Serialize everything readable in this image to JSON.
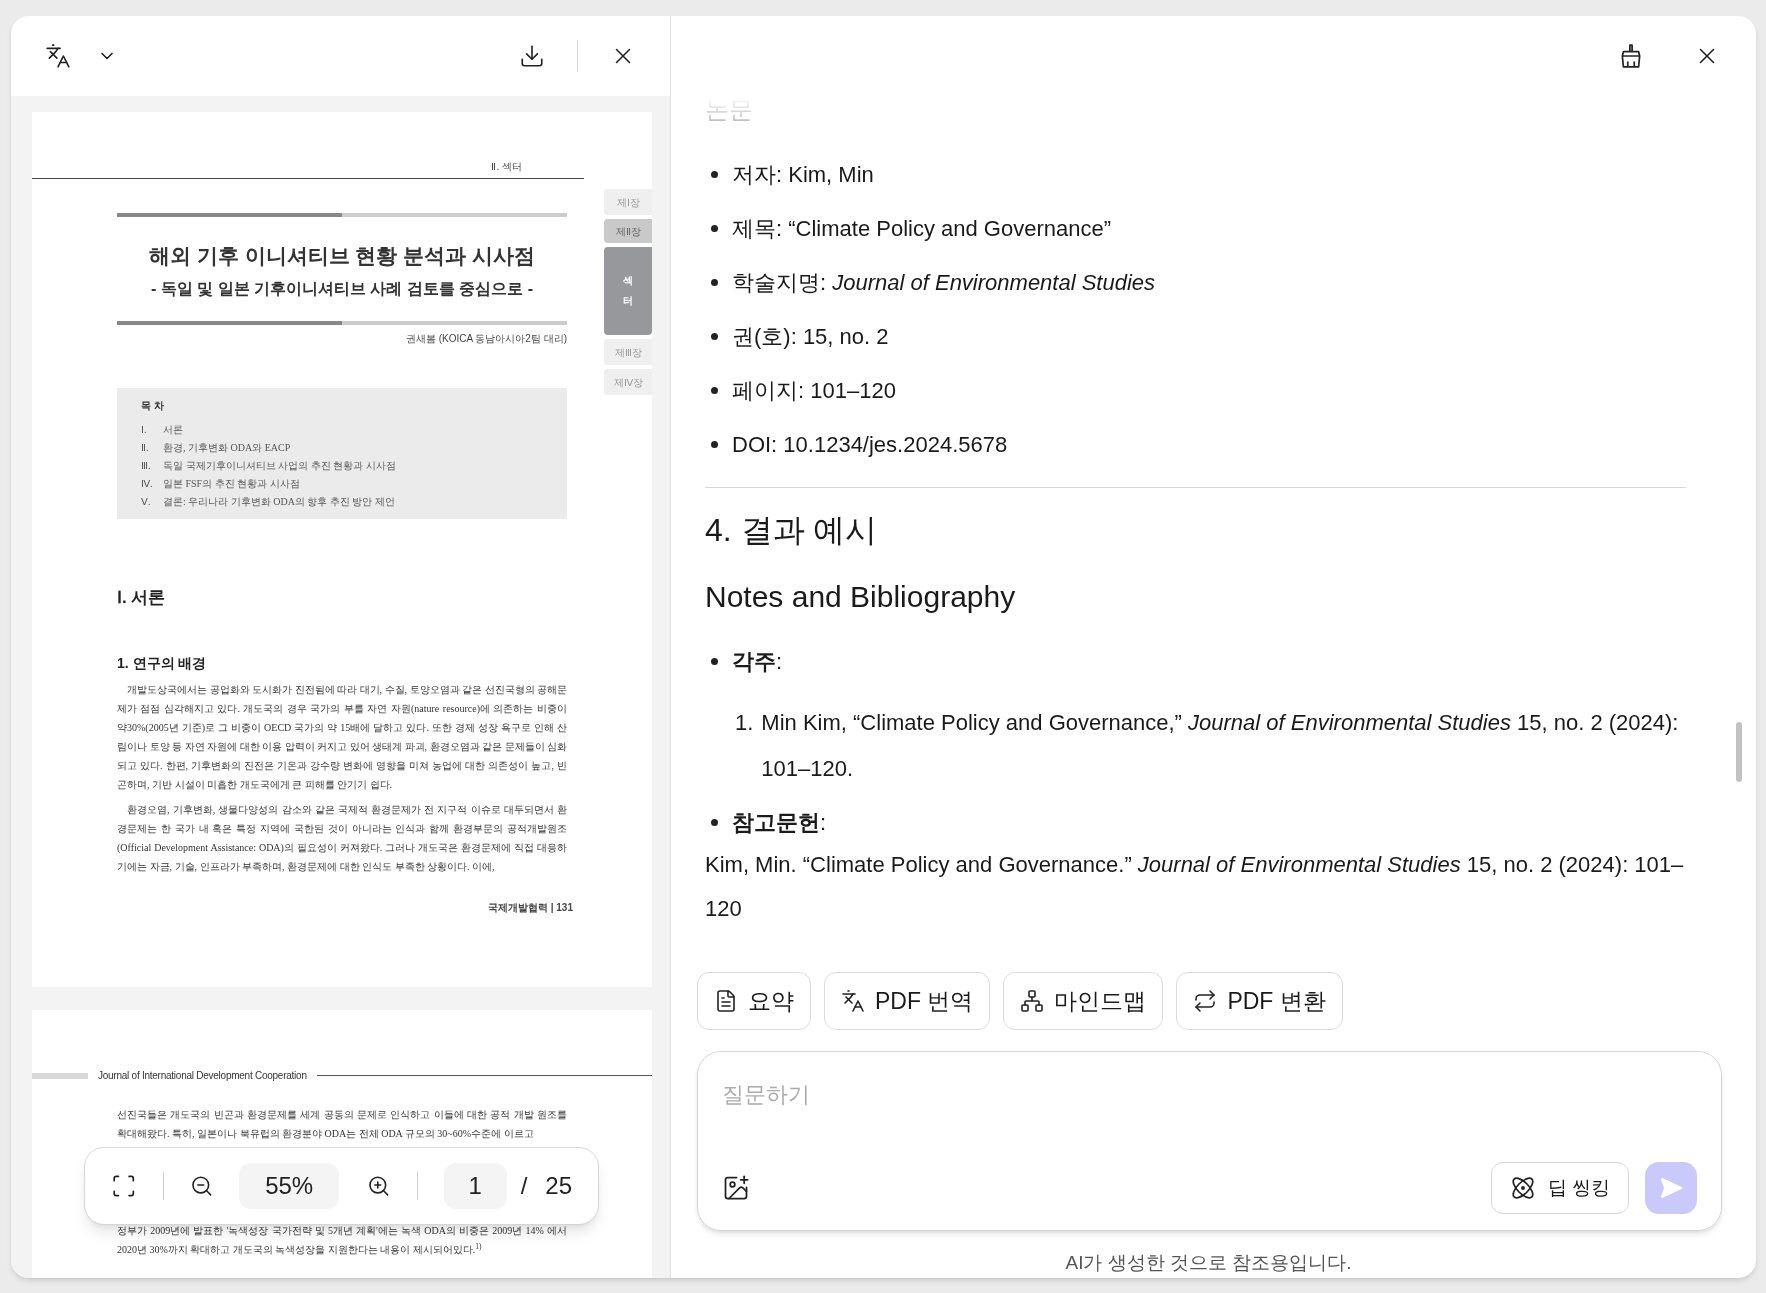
{
  "viewer_header": {
    "translate_menu_expanded": false
  },
  "pages": [
    {
      "running_header": "Ⅱ. 섹터",
      "title": "해외 기후 이니셔티브 현황 분석과 시사점",
      "subtitle": "- 독일 및 일본 기후이니셔티브 사례 검토를 중심으로 -",
      "author": "권새봄 (KOICA 동남아시아2팀 대리)",
      "toc": {
        "heading": "목 차",
        "items": [
          {
            "number": "Ⅰ.",
            "text": "서론"
          },
          {
            "number": "Ⅱ.",
            "text": "환경, 기후변화 ODA와 EACP"
          },
          {
            "number": "Ⅲ.",
            "text": "독일 국제기후이니셔티브 사업의 추진 현황과 시사점"
          },
          {
            "number": "Ⅳ.",
            "text": "일본 FSF의 추진 현황과 시사점"
          },
          {
            "number": "Ⅴ.",
            "text": "결론: 우리나라 기후변화 ODA의 향후 추진 방안 제언"
          }
        ]
      },
      "chapter_tabs": [
        {
          "label": "제Ⅰ장",
          "kind": "other"
        },
        {
          "label": "제Ⅱ장",
          "kind": "current"
        },
        {
          "label": "섹터",
          "kind": "section"
        },
        {
          "label": "제Ⅲ장",
          "kind": "other"
        },
        {
          "label": "제Ⅳ장",
          "kind": "other"
        }
      ],
      "section_heading": "Ⅰ. 서론",
      "subsection_heading": "1. 연구의 배경",
      "paragraphs": [
        "개발도상국에서는 공업화와 도시화가 진전됨에 따라 대기, 수질, 토양오염과 같은 선진국형의 공해문제가 점점 심각해지고 있다. 개도국의 경우 국가의 부를 자연 자원(nature resource)에 의존하는 비중이 약30%(2005년 기준)로 그 비중이 OECD 국가의 약 15배에 달하고 있다. 또한 경제 성장 욕구로 인해 산림이나 토양 등 자연 자원에 대한 이용 압력이 커지고 있어 생태계 파괴, 환경오염과 같은 문제들이 심화되고 있다. 한편, 기후변화의 진전은 기온과 강수량 변화에 영향을 미쳐 농업에 대한 의존성이 높고, 빈곤하며, 기반 시설이 미흡한 개도국에게 큰 피해를 안기기 쉽다.",
        "환경오염, 기후변화, 생물다양성의 감소와 같은 국제적 환경문제가 전 지구적 이슈로 대두되면서 환경문제는 한 국가 내 혹은 특정 지역에 국한된 것이 아니라는 인식과 함께 환경부문의 공적개발원조 (Official Development Assistance: ODA)의 필요성이 커져왔다. 그러나 개도국은 환경문제에 직접 대응하기에는 자금, 기술, 인프라가 부족하며, 환경문제에 대한 인식도 부족한 상황이다. 이에,"
      ],
      "footer": "국제개발협력 | 131"
    },
    {
      "running_header": "Journal of International Development Cooperation",
      "text_above": "선진국들은 개도국의 빈곤과 환경문제를 세계 공동의 문제로 인식하고 이들에 대한 공적 개발 원조를 확대해왔다. 특히, 일본이나 북유럽의 환경분야 ODA는 전체 ODA 규모의 30~60%수준에 이르고",
      "text_below": "정부가 2009년에 발표한 '녹색성장 국가전략 및 5개년 계획'에는 녹색 ODA의 비중은 2009년 14% 에서 2020년 30%까지 확대하고 개도국의 녹색성장을 지원한다는 내용이 제시되어있다.$^{1)}$"
    }
  ],
  "viewer_toolbar": {
    "zoom": "55%",
    "page": "1",
    "separator": "/",
    "page_count": "25"
  },
  "answer": {
    "faded_heading": "논문",
    "details": [
      "저자: Kim, Min",
      "제목: “Climate Policy and Governance”",
      "학술지명: *Journal of Environmental Studies*",
      "권(호): 15, no. 2",
      "페이지: 101–120",
      "DOI: 10.1234/jes.2024.5678"
    ],
    "heading": "4. 결과 예시",
    "subheading": "Notes and Bibliography",
    "notes": {
      "label": "**각주**:",
      "items": [
        {
          "number": "1.",
          "text": "Min Kim, “Climate Policy and Governance,” *Journal of Environmental Studies* 15, no. 2 (2024): 101–120."
        }
      ]
    },
    "bibliography": {
      "label": "**참고문헌**:",
      "entry": "Kim, Min. “Climate Policy and Governance.” *Journal of Environmental Studies* 15, no. 2 (2024): 101–120"
    }
  },
  "actions": [
    {
      "label": "요약",
      "kind": "summary"
    },
    {
      "label": "PDF 번역",
      "kind": "translate"
    },
    {
      "label": "마인드맵",
      "kind": "mindmap"
    },
    {
      "label": "PDF 변환",
      "kind": "convert"
    }
  ],
  "composer": {
    "placeholder": "질문하기",
    "deep_thinking": "딥 씽킹",
    "send_enabled": false
  },
  "disclaimer": "AI가 생성한 것으로 참조용입니다."
}
